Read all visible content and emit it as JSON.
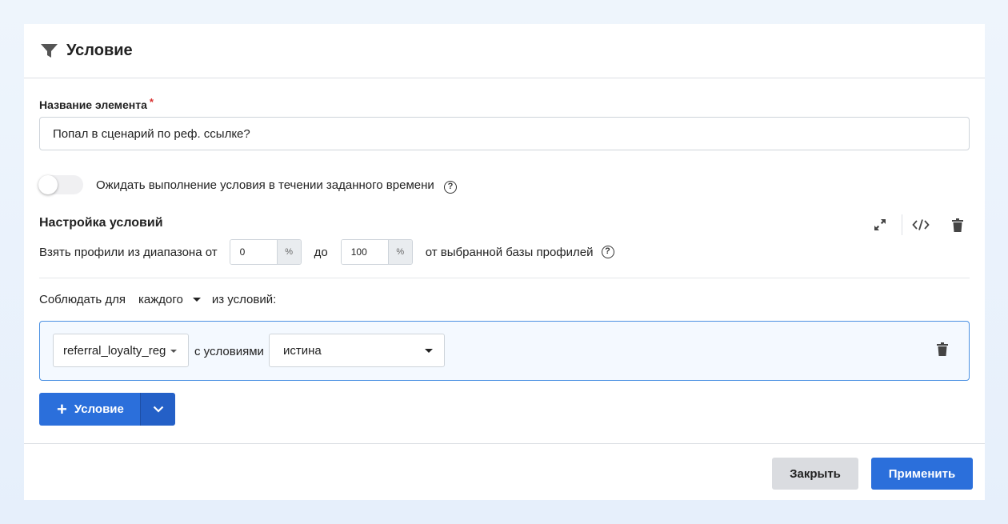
{
  "header": {
    "title": "Условие",
    "icon": "filter-icon"
  },
  "element_name": {
    "label": "Название элемента",
    "required_mark": "*",
    "value": "Попал в сценарий по реф. ссылке?"
  },
  "wait_toggle": {
    "label": "Ожидать выполнение условия в течении заданного времени",
    "enabled": false,
    "help_icon": "?"
  },
  "conditions_settings": {
    "title": "Настройка условий",
    "tools": [
      "expand-icon",
      "code-icon",
      "trash-icon"
    ],
    "range": {
      "prefix": "Взять профили из диапазона от",
      "from_value": "0",
      "from_unit": "%",
      "middle": "до",
      "to_value": "100",
      "to_unit": "%",
      "suffix": "от выбранной базы профилей",
      "help_icon": "?"
    }
  },
  "match": {
    "prefix": "Соблюдать для",
    "selected": "каждого",
    "suffix": "из условий:"
  },
  "condition": {
    "field": "referral_loyalty_reg",
    "text": "с условиями",
    "operator": "истина"
  },
  "add_button": {
    "label": "Условие",
    "plus": "+"
  },
  "footer": {
    "close_label": "Закрыть",
    "apply_label": "Применить"
  },
  "colors": {
    "primary": "#2b6fdb",
    "border_active": "#4a90e2",
    "required": "#d9302f"
  }
}
